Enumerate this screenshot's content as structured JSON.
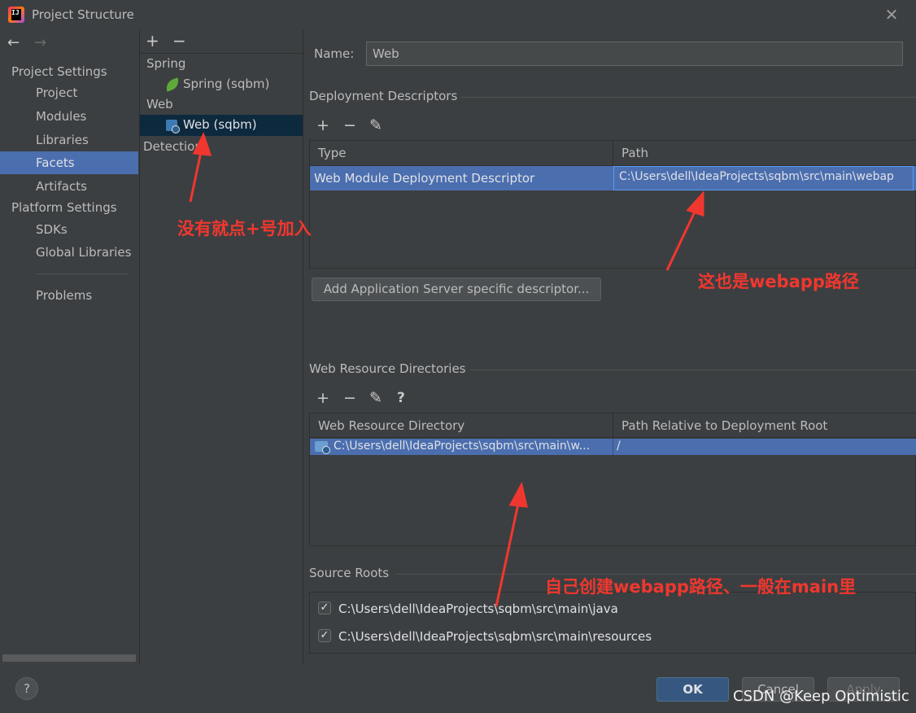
{
  "window": {
    "title": "Project Structure"
  },
  "nav": {
    "project_settings": "Project Settings",
    "items_project": [
      "Project",
      "Modules",
      "Libraries",
      "Facets",
      "Artifacts"
    ],
    "platform_settings": "Platform Settings",
    "items_platform": [
      "SDKs",
      "Global Libraries"
    ],
    "problems": "Problems",
    "selected": "Facets"
  },
  "facets_tree": {
    "groups": [
      {
        "label": "Spring",
        "child": "Spring (sqbm)"
      },
      {
        "label": "Web",
        "child": "Web (sqbm)"
      }
    ],
    "detection": "Detection"
  },
  "detail": {
    "name_label": "Name:",
    "name_value": "Web",
    "deployment_descriptors": "Deployment Descriptors",
    "dd_table": {
      "headers": [
        "Type",
        "Path"
      ],
      "row": {
        "type": "Web Module Deployment Descriptor",
        "path": "C:\\Users\\dell\\IdeaProjects\\sqbm\\src\\main\\webap"
      }
    },
    "add_server_descriptor": "Add Application Server specific descriptor...",
    "web_resource_dirs": "Web Resource Directories",
    "wr_table": {
      "headers": [
        "Web Resource Directory",
        "Path Relative to Deployment Root"
      ],
      "row": {
        "dir": "C:\\Users\\dell\\IdeaProjects\\sqbm\\src\\main\\w...",
        "rel": "/"
      }
    },
    "source_roots": "Source Roots",
    "roots": [
      {
        "checked": true,
        "path": "C:\\Users\\dell\\IdeaProjects\\sqbm\\src\\main\\java"
      },
      {
        "checked": true,
        "path": "C:\\Users\\dell\\IdeaProjects\\sqbm\\src\\main\\resources"
      }
    ]
  },
  "buttons": {
    "ok": "OK",
    "cancel": "Cancel",
    "apply": "Apply",
    "help": "?"
  },
  "annotations": {
    "a1": "没有就点+号加入",
    "a2": "这也是webapp路径",
    "a3": "自己创建webapp路径、一般在main里"
  },
  "watermark": "CSDN @Keep Optimistic",
  "colors": {
    "accent": "#4b6eaf",
    "annotation": "#f0372f",
    "ok_button": "#365880"
  }
}
